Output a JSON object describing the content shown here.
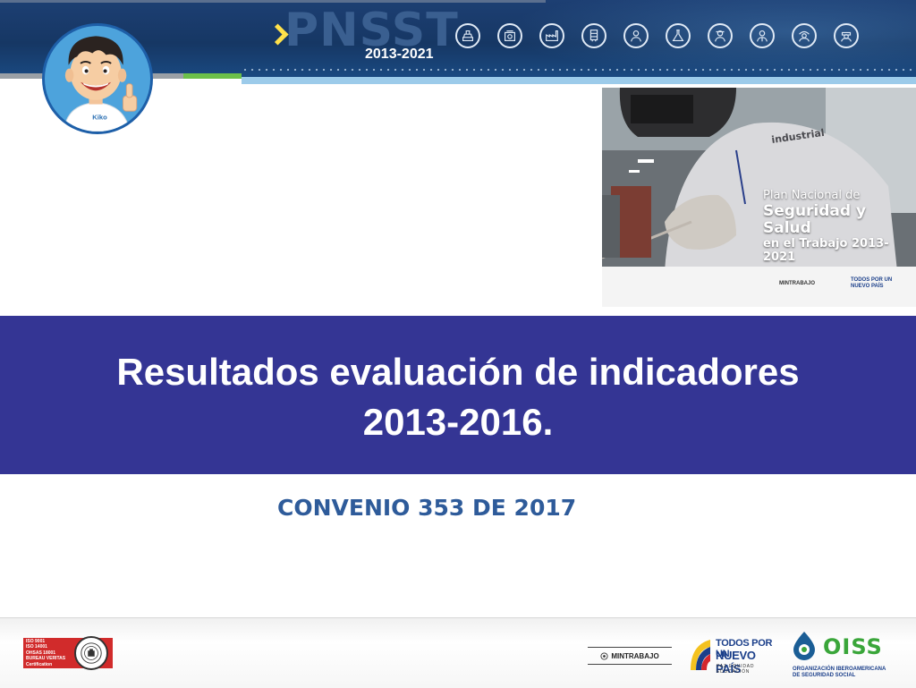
{
  "header": {
    "brand": "PNSST",
    "years": "2013-2021",
    "icon_names": [
      "worker-construction-icon",
      "worker-mining-icon",
      "worker-industry-icon",
      "worker-transport-icon",
      "worker-health-icon",
      "worker-chemical-icon",
      "worker-security-icon",
      "worker-office-icon",
      "worker-agriculture-icon",
      "worker-services-icon"
    ]
  },
  "mascot": {
    "shirt_label": "Kiko"
  },
  "cover": {
    "title_line1": "Plan Nacional de",
    "title_line2": "Seguridad y Salud",
    "title_line3": "en el Trabajo 2013-2021",
    "logo_mintrabajo": "MINTRABAJO",
    "logo_tpunp_1": "TODOS POR UN",
    "logo_tpunp_2": "NUEVO PAÍS"
  },
  "main": {
    "title_line1": "Resultados evaluación de indicadores",
    "title_line2": "2013-2016.",
    "subtitle": "CONVENIO 353 DE 2017"
  },
  "footer": {
    "bv_lines": [
      "ISO 9001",
      "ISO 14001",
      "OHSAS 18001",
      "BUREAU VERITAS",
      "Certification"
    ],
    "mintrabajo": "MINTRABAJO",
    "tpunp_line1": "TODOS POR UN",
    "tpunp_line2": "NUEVO PAÍS",
    "tpunp_line3": "PAZ  EQUIDAD  EDUCACIÓN",
    "oiss_name": "OISS",
    "oiss_sub_line1": "ORGANIZACIÓN IBEROAMERICANA",
    "oiss_sub_line2": "DE SEGURIDAD SOCIAL"
  },
  "colors": {
    "banner": "#163764",
    "band": "#343594",
    "subtitle": "#2e5b9a",
    "accent_green": "#6cc04a",
    "accent_yellow": "#ffe14a",
    "oiss_green": "#3aa63a",
    "bv_red": "#d12b2b"
  }
}
